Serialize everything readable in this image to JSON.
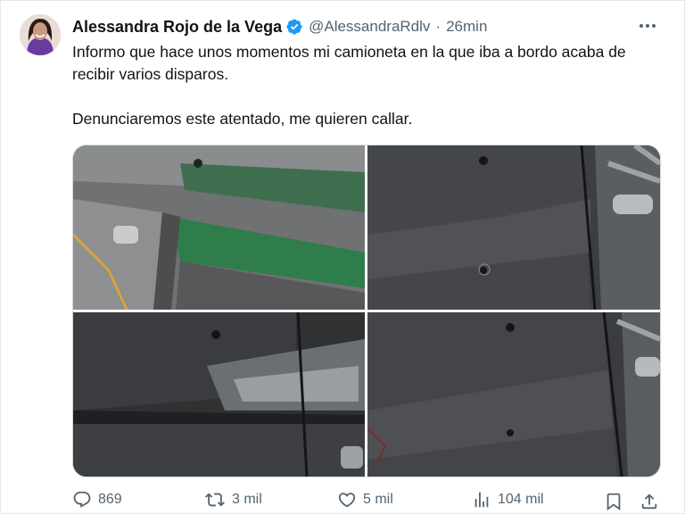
{
  "tweet": {
    "author_name": "Alessandra Rojo de la Vega",
    "handle": "@AlessandraRdlv",
    "separator": "·",
    "time": "26min",
    "text_line1": "Informo que hace unos momentos mi camioneta en la que iba a bordo acaba de recibir varios disparos.",
    "text_line2": "Denunciaremos este atentado, me quieren callar."
  },
  "actions": {
    "replies": "869",
    "reposts": "3 mil",
    "likes": "5 mil",
    "views": "104 mil"
  },
  "icons": {
    "verified": "verified-badge-icon",
    "more": "more-dots-icon",
    "reply": "reply-icon",
    "repost": "repost-icon",
    "like": "heart-icon",
    "views": "views-chart-icon",
    "bookmark": "bookmark-icon",
    "share": "share-icon"
  },
  "colors": {
    "verified_blue": "#1d9bf0",
    "secondary_text": "#536471",
    "green_paint": "#2e7d4a"
  }
}
